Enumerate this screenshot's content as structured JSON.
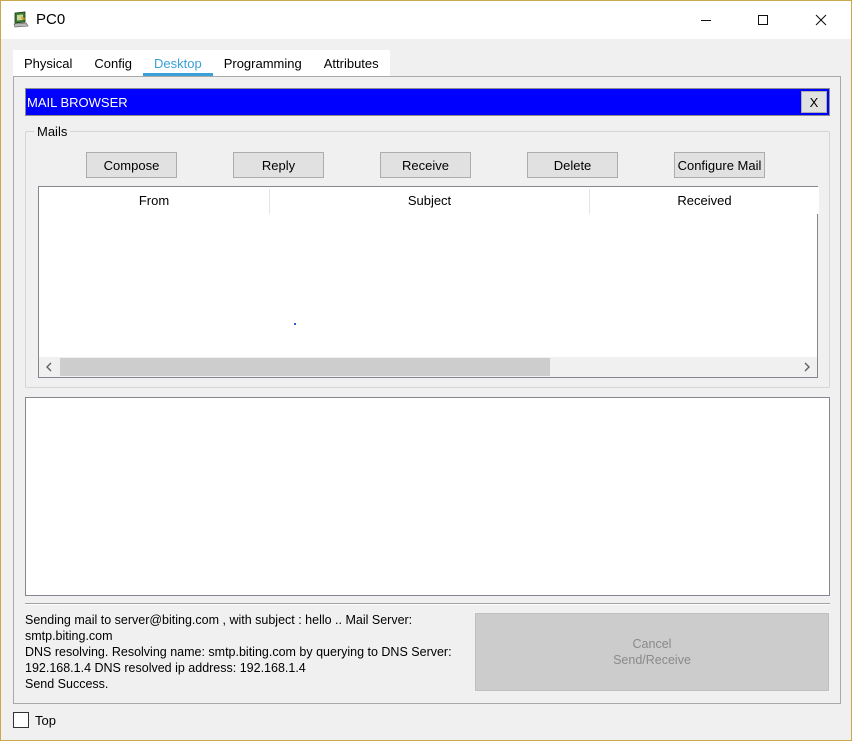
{
  "window": {
    "title": "PC0"
  },
  "tabs": [
    {
      "label": "Physical",
      "active": false
    },
    {
      "label": "Config",
      "active": false
    },
    {
      "label": "Desktop",
      "active": true
    },
    {
      "label": "Programming",
      "active": false
    },
    {
      "label": "Attributes",
      "active": false
    }
  ],
  "mail_browser": {
    "title": "MAIL BROWSER",
    "close_label": "X",
    "group_label": "Mails",
    "buttons": {
      "compose": "Compose",
      "reply": "Reply",
      "receive": "Receive",
      "delete": "Delete",
      "configure": "Configure Mail"
    },
    "columns": [
      "From",
      "Subject",
      "Received"
    ],
    "rows": [],
    "message_body": ""
  },
  "status": {
    "lines": [
      "Sending mail to server@biting.com , with subject : hello ..   Mail Server:",
      "smtp.biting.com",
      "DNS resolving. Resolving name: smtp.biting.com by querying to DNS Server:",
      "192.168.1.4  DNS resolved ip address: 192.168.1.4",
      "Send Success."
    ]
  },
  "cancel_button": {
    "line1": "Cancel",
    "line2": "Send/Receive"
  },
  "top_checkbox": {
    "label": "Top",
    "checked": false
  },
  "colors": {
    "header_blue": "#0000ff",
    "tab_active": "#3aa0d8"
  }
}
